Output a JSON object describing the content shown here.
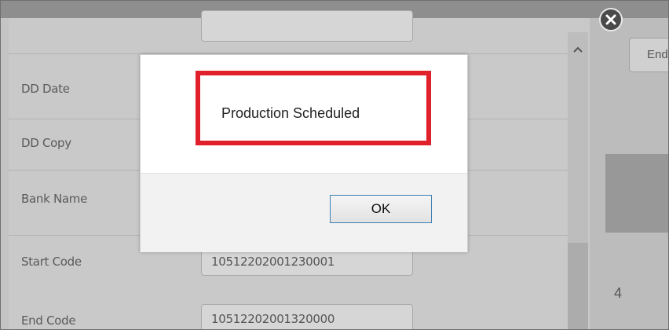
{
  "form": {
    "rows": [
      {
        "label": "DD Date",
        "value": ""
      },
      {
        "label": "DD Copy",
        "value": ""
      },
      {
        "label": "Bank Name",
        "value": ""
      },
      {
        "label": "Start Code",
        "value": "10512202001230001"
      },
      {
        "label": "End Code",
        "value": "10512202001320000"
      }
    ]
  },
  "right_panel": {
    "field_text": "End",
    "number": "4"
  },
  "dialog": {
    "message": "Production Scheduled",
    "ok_label": "OK",
    "highlight_color": "#e0212b"
  },
  "icons": {
    "close": "close-icon",
    "scroll_up": "chevron-up-icon"
  }
}
